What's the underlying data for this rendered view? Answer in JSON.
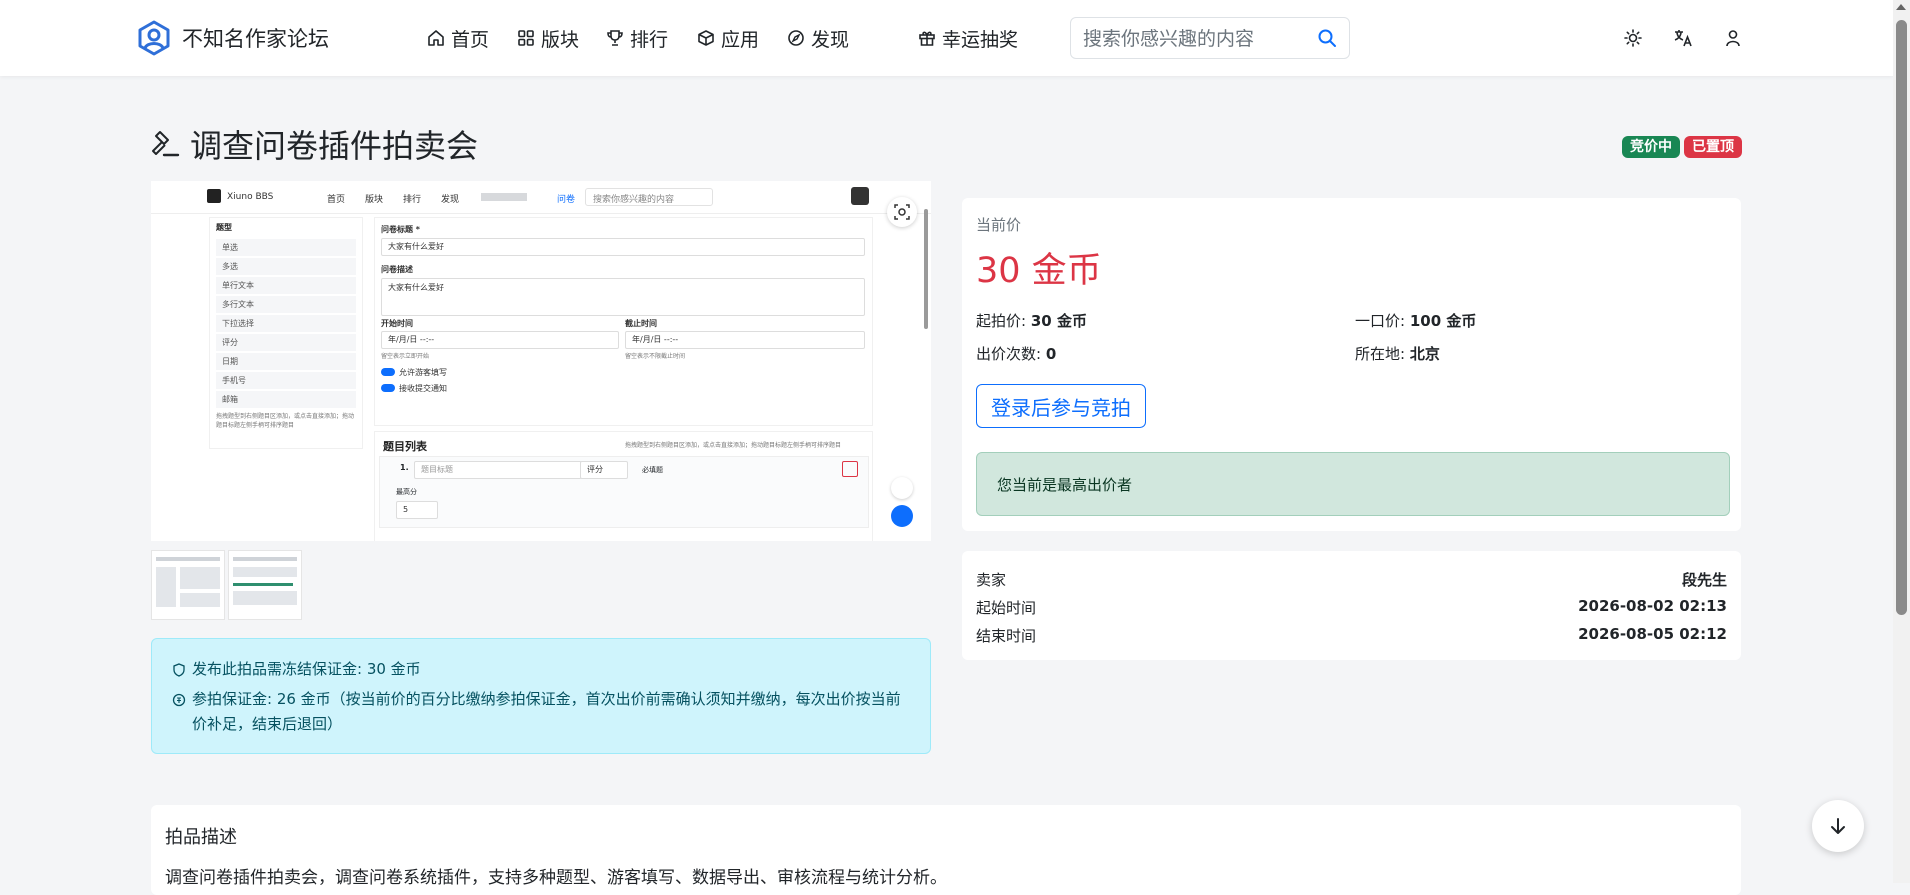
{
  "nav": {
    "brand": "不知名作家论坛",
    "items": [
      {
        "label": "首页",
        "icon": "home-icon"
      },
      {
        "label": "版块",
        "icon": "grid-icon"
      },
      {
        "label": "排行",
        "icon": "trophy-icon"
      },
      {
        "label": "应用",
        "icon": "box-icon"
      },
      {
        "label": "发现",
        "icon": "compass-icon"
      },
      {
        "label": "幸运抽奖",
        "icon": "gift-icon"
      }
    ],
    "search_placeholder": "搜索你感兴趣的内容",
    "tools": [
      "sun-icon",
      "translate-icon",
      "user-icon"
    ]
  },
  "page": {
    "title": "调查问卷插件拍卖会",
    "badges": [
      {
        "label": "竞价中",
        "color": "#198754"
      },
      {
        "label": "已置顶",
        "color": "#dc3545"
      }
    ]
  },
  "preview": {
    "brand": "Xiuno BBS",
    "nav": [
      "首页",
      "版块",
      "排行",
      "发现"
    ],
    "active": "问卷",
    "search": "搜索你感兴趣的内容",
    "side_title": "题型",
    "side_items": [
      "单选",
      "多选",
      "单行文本",
      "多行文本",
      "下拉选择",
      "评分",
      "日期",
      "手机号",
      "邮箱"
    ],
    "side_hint": "拖拽题型到右侧题目区添加，或点击直接添加；拖动题目标题左侧手柄可排序题目",
    "form_title_label": "问卷标题 *",
    "form_title_value": "大家有什么爱好",
    "form_desc_label": "问卷描述",
    "form_desc_value": "大家有什么爱好",
    "start_label": "开始时间",
    "end_label": "截止时间",
    "date_placeholder": "年/月/日 --:--",
    "start_hint": "留空表示立即开始",
    "end_hint": "留空表示不限截止时间",
    "toggle1": "允许游客填写",
    "toggle2": "接收提交通知",
    "list_title": "题目列表",
    "list_hint": "拖拽题型到右侧题目区添加，或点击直接添加；拖动题目标题左侧手柄可排序题目",
    "q_number": "1.",
    "q_placeholder": "题目标题",
    "q_type": "评分",
    "q_required": "必填题",
    "q_max_label": "最高分",
    "q_max_value": "5"
  },
  "deposit": {
    "line1": "发布此拍品需冻结保证金: 30 金币",
    "line2": "参拍保证金: 26 金币（按当前价的百分比缴纳参拍保证金，首次出价前需确认须知并缴纳，每次出价按当前价补足，结束后退回）"
  },
  "auction": {
    "current_label": "当前价",
    "current_price": "30 金币",
    "start_label": "起拍价:",
    "start_value": "30 金币",
    "buyout_label": "一口价:",
    "buyout_value": "100 金币",
    "bids_label": "出价次数:",
    "bids_value": "0",
    "location_label": "所在地:",
    "location_value": "北京",
    "bid_button": "登录后参与竞拍",
    "status_alert": "您当前是最高出价者"
  },
  "meta": {
    "seller_label": "卖家",
    "seller_value": "段先生",
    "start_time_label": "起始时间",
    "start_time_value": "2026-08-02 02:13",
    "end_time_label": "结束时间",
    "end_time_value": "2026-08-05 02:12"
  },
  "description": {
    "title": "拍品描述",
    "text": "调查问卷插件拍卖会，调查问卷系统插件，支持多种题型、游客填写、数据导出、审核流程与统计分析。"
  }
}
